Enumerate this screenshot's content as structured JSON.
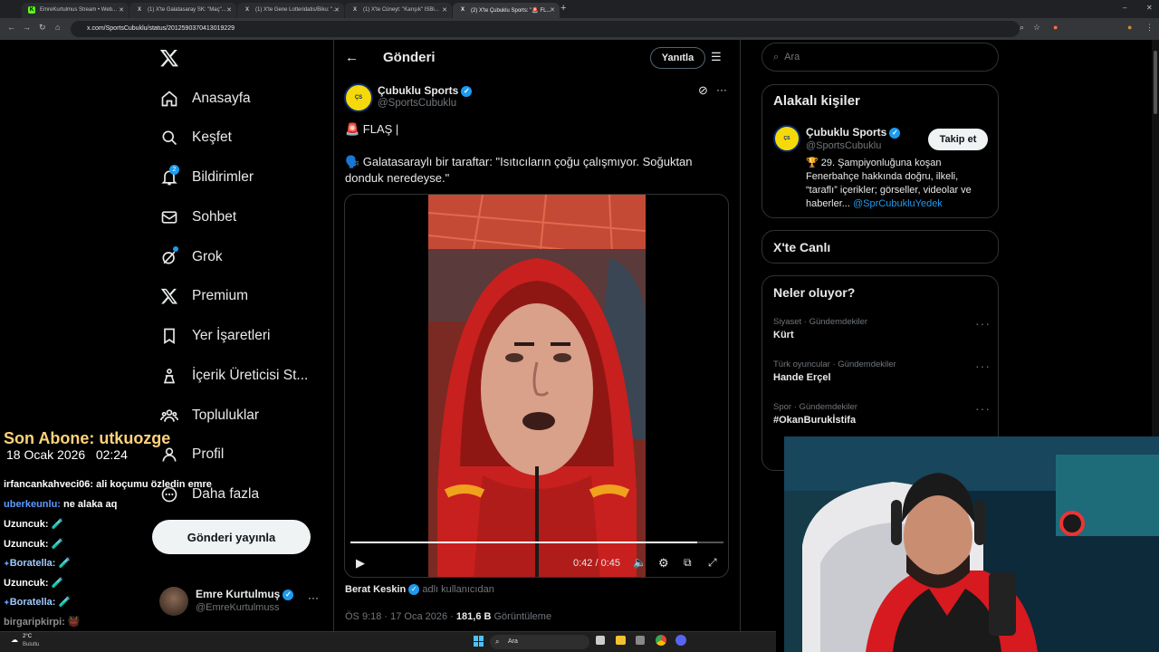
{
  "tabs": [
    {
      "label": "EmreKurtulmus Stream • Web...",
      "fav": "K",
      "fav_color": "#53fc18"
    },
    {
      "label": "(1) X'te Galatasaray SK: \"Maç\"...",
      "fav": "X",
      "fav_color": "#ffffff"
    },
    {
      "label": "(1) X'te Gene Lotteridatis/Biku: \"...",
      "fav": "X",
      "fav_color": "#ffffff"
    },
    {
      "label": "(1) X'te Cüneyt: \"Karışık\" ISBi...",
      "fav": "X",
      "fav_color": "#ffffff"
    },
    {
      "label": "(2) X'te Çubuklu Sports: \"🚨 FL...",
      "fav": "X",
      "fav_color": "#ffffff"
    }
  ],
  "browser": {
    "url": "x.com/SportsCubuklu/status/2012590370413019229"
  },
  "sidebar": {
    "items": [
      {
        "label": "Anasayfa",
        "icon": "home-icon"
      },
      {
        "label": "Keşfet",
        "icon": "search-icon"
      },
      {
        "label": "Bildirimler",
        "icon": "bell-icon",
        "badge": "2"
      },
      {
        "label": "Sohbet",
        "icon": "mail-icon"
      },
      {
        "label": "Grok",
        "icon": "grok-icon"
      },
      {
        "label": "Premium",
        "icon": "x-icon"
      },
      {
        "label": "Yer İşaretleri",
        "icon": "bookmark-icon"
      },
      {
        "label": "İçerik Üreticisi St...",
        "icon": "creator-icon"
      },
      {
        "label": "Topluluklar",
        "icon": "communities-icon"
      },
      {
        "label": "Profil",
        "icon": "profile-icon"
      },
      {
        "label": "Daha fazla",
        "icon": "more-icon"
      }
    ],
    "post_button": "Gönderi yayınla",
    "account": {
      "name": "Emre Kurtulmuş",
      "handle": "@EmreKurtulmuss"
    }
  },
  "header": {
    "title": "Gönderi",
    "reply_button": "Yanıtla"
  },
  "post": {
    "author": "Çubuklu Sports",
    "handle": "@SportsCubuklu",
    "line1": "🚨 FLAŞ |",
    "line2": "🗣️ Galatasaraylı bir taraftar: \"Isıtıcıların çoğu çalışmıyor. Soğuktan donduk neredeyse.\"",
    "video_time": "0:42 / 0:45",
    "video_progress": 0.93,
    "credit_name": "Berat Keskin",
    "credit_suffix": "adlı kullanıcıdan",
    "meta_time": "ÖS 9:18 · 17 Oca 2026 · ",
    "views_count": "181,6 B",
    "views_label": " Görüntüleme"
  },
  "right": {
    "search_placeholder": "Ara",
    "related_title": "Alakalı kişiler",
    "related": {
      "name": "Çubuklu Sports",
      "handle": "@SportsCubuklu",
      "follow": "Takip et",
      "bio": "🏆 29. Şampiyonluğuna koşan Fenerbahçe hakkında doğru, ilkeli, “taraflı” içerikler; görseller, videolar ve haberler... ",
      "bio_link": "@SprCubukluYedek"
    },
    "live_title": "X'te Canlı",
    "trends_title": "Neler oluyor?",
    "trends": [
      {
        "meta": "Siyaset · Gündemdekiler",
        "name": "Kürt"
      },
      {
        "meta": "Türk oyuncular · Gündemdekiler",
        "name": "Hande Erçel"
      },
      {
        "meta": "Spor · Gündemdekiler",
        "name": "#OkanBurukİstifa"
      }
    ]
  },
  "overlay": {
    "subscriber": "Son Abone: utkuozge",
    "date": "18 Ocak 2026",
    "time": "02:24",
    "chat": [
      {
        "user": "irfancankahveci06:",
        "msg": " ali koçumu özledin emre",
        "color": "#ffffff"
      },
      {
        "user": "uberkeunlu:",
        "msg": " ne alaka aq",
        "color": "#5b9cff"
      },
      {
        "user": "Uzuncuk:",
        "msg": " 🧪",
        "color": "#ffffff"
      },
      {
        "user": "Uzuncuk:",
        "msg": " 🧪",
        "color": "#ffffff"
      },
      {
        "user": "Boratella:",
        "msg": " 🧪",
        "color": "#9ecbff"
      },
      {
        "user": "Uzuncuk:",
        "msg": " 🧪",
        "color": "#ffffff"
      },
      {
        "user": "Boratella:",
        "msg": " 🧪",
        "color": "#9ecbff"
      },
      {
        "user": "birgaripkirpi:",
        "msg": " 👹",
        "color": "#cccccc"
      }
    ]
  },
  "taskbar": {
    "weather_temp": "2°C",
    "weather_desc": "Bulutlu",
    "search": "Ara"
  }
}
